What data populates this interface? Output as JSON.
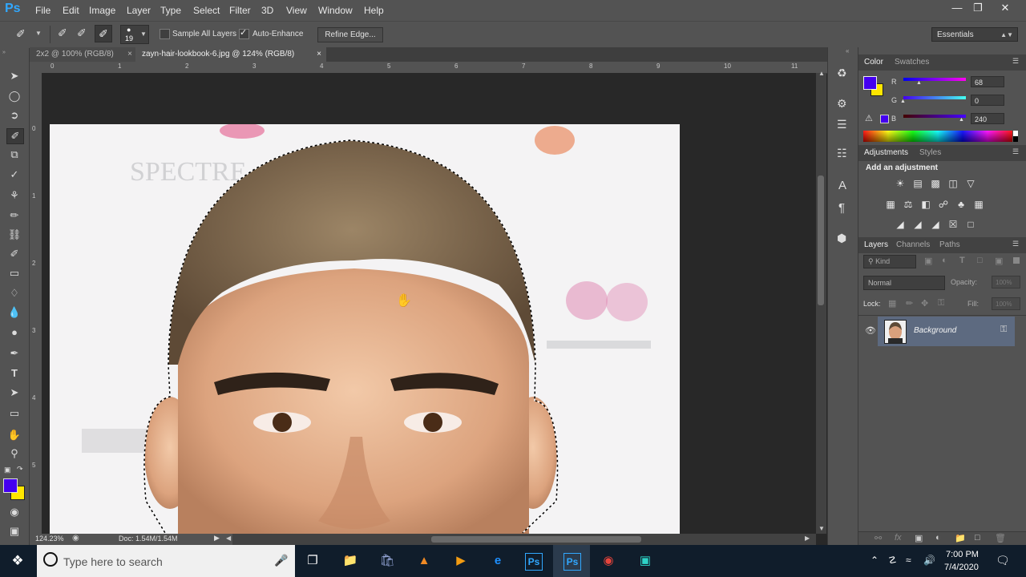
{
  "app": {
    "logo": "Ps"
  },
  "menu": [
    "File",
    "Edit",
    "Image",
    "Layer",
    "Type",
    "Select",
    "Filter",
    "3D",
    "View",
    "Window",
    "Help"
  ],
  "window_controls": {
    "minimize": "—",
    "restore": "❐",
    "close": "✕"
  },
  "options": {
    "brush_size": "19",
    "sample_all_layers": "Sample All Layers",
    "sample_all_layers_checked": false,
    "auto_enhance": "Auto-Enhance",
    "auto_enhance_checked": true,
    "refine_edge": "Refine Edge...",
    "workspace": "Essentials"
  },
  "tabs": [
    {
      "label": "2x2 @ 100% (RGB/8)",
      "active": false
    },
    {
      "label": "zayn-hair-lookbook-6.jpg @ 124% (RGB/8)",
      "active": true
    }
  ],
  "ruler_h": [
    "0",
    "1",
    "2",
    "3",
    "4",
    "5",
    "6",
    "7",
    "8",
    "9",
    "10",
    "11"
  ],
  "ruler_v": [
    "0",
    "1",
    "2",
    "3",
    "4",
    "5"
  ],
  "status": {
    "zoom": "124.23%",
    "doc": "Doc: 1.54M/1.54M"
  },
  "color_panel": {
    "tabs": [
      "Color",
      "Swatches"
    ],
    "fg": "#4400f0",
    "bg": "#ffe600",
    "channels": [
      {
        "name": "R",
        "value": "68"
      },
      {
        "name": "G",
        "value": "0"
      },
      {
        "name": "B",
        "value": "240"
      }
    ]
  },
  "adjustments_panel": {
    "tabs": [
      "Adjustments",
      "Styles"
    ],
    "heading": "Add an adjustment",
    "icons": [
      "brightness-icon",
      "levels-icon",
      "curves-icon",
      "exposure-icon",
      "vibrance-icon",
      "hue-saturation-icon",
      "color-balance-icon",
      "black-white-icon",
      "photo-filter-icon",
      "channel-mixer-icon",
      "color-lookup-icon",
      "invert-icon",
      "posterize-icon",
      "threshold-icon",
      "selective-color-icon",
      "gradient-map-icon"
    ]
  },
  "layers_panel": {
    "tabs": [
      "Layers",
      "Channels",
      "Paths"
    ],
    "kind": "Kind",
    "blend_mode": "Normal",
    "opacity_label": "Opacity:",
    "opacity": "100%",
    "lock_label": "Lock:",
    "fill_label": "Fill:",
    "fill": "100%",
    "layers": [
      {
        "name": "Background",
        "visible": true,
        "locked": true
      }
    ]
  },
  "taskbar": {
    "search_placeholder": "Type here to search",
    "time": "7:00 PM",
    "date": "7/4/2020"
  }
}
